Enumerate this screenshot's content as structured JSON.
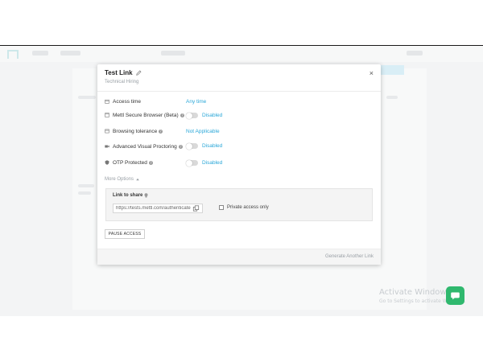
{
  "modal": {
    "title": "Test Link",
    "subtitle": "Technical Hiring",
    "close_label": "×",
    "rows": [
      {
        "label": "Access time",
        "value": "Any time",
        "type": "link"
      },
      {
        "label": "Mettl Secure Browser (Beta)",
        "value": "Disabled",
        "type": "toggle"
      },
      {
        "label": "Browsing tolerance",
        "value": "Not Applicable",
        "type": "link"
      },
      {
        "label": "Advanced Visual Proctoring",
        "value": "Disabled",
        "type": "toggle"
      },
      {
        "label": "OTP Protected",
        "value": "Disabled",
        "type": "toggle"
      }
    ],
    "more_options": "More Options",
    "share": {
      "label": "Link to share",
      "link_value": "https://tests.mettl.com/authenticate",
      "private_label": "Private access only"
    },
    "pause_label": "PAUSE ACCESS",
    "generate_label": "Generate Another Link"
  },
  "windows": {
    "title": "Activate Windows",
    "subtitle": "Go to Settings to activate Windows."
  },
  "colors": {
    "accent": "#2aa7d8",
    "chat": "#2fb86e"
  }
}
